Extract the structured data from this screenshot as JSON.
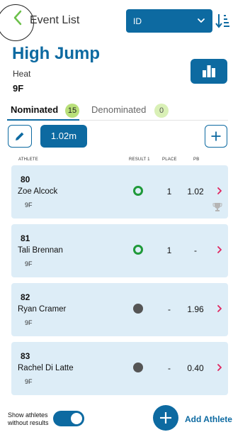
{
  "header": {
    "back_label": "Event List",
    "sort_value": "ID"
  },
  "event": {
    "title": "High Jump",
    "round": "Heat",
    "class": "9F"
  },
  "tabs": [
    {
      "label": "Nominated",
      "count": "15",
      "active": true
    },
    {
      "label": "Denominated",
      "count": "0",
      "active": false
    }
  ],
  "toolbar": {
    "height_value": "1.02m"
  },
  "columns": {
    "athlete": "ATHLETE",
    "result": "RESULT 1",
    "place": "PLACE",
    "pb": "PB"
  },
  "athletes": [
    {
      "bib": "80",
      "name": "Zoe Alcock",
      "class": "9F",
      "result": "pass",
      "place": "1",
      "pb": "1.02",
      "trophy": true
    },
    {
      "bib": "81",
      "name": "Tali Brennan",
      "class": "9F",
      "result": "pass",
      "place": "1",
      "pb": "-",
      "trophy": false
    },
    {
      "bib": "82",
      "name": "Ryan Cramer",
      "class": "9F",
      "result": "none",
      "place": "-",
      "pb": "1.96",
      "trophy": false
    },
    {
      "bib": "83",
      "name": "Rachel Di Latte",
      "class": "9F",
      "result": "none",
      "place": "-",
      "pb": "0.40",
      "trophy": false
    }
  ],
  "footer": {
    "toggle_label_line1": "Show athletes",
    "toggle_label_line2": "without results",
    "toggle_on": true,
    "add_label": "Add Athlete"
  },
  "colors": {
    "primary": "#0d6aa1",
    "card": "#ddedf7",
    "pass": "#1f9a3a",
    "badge": "#b9e07a",
    "chevron": "#e0245e",
    "back_chevron": "#6cc04a"
  },
  "icons": {
    "back": "chevron-left-icon",
    "sort": "sort-icon",
    "chart": "bar-chart-icon",
    "edit": "pencil-icon",
    "add": "plus-icon",
    "row": "chevron-right-icon",
    "trophy": "trophy-icon"
  }
}
